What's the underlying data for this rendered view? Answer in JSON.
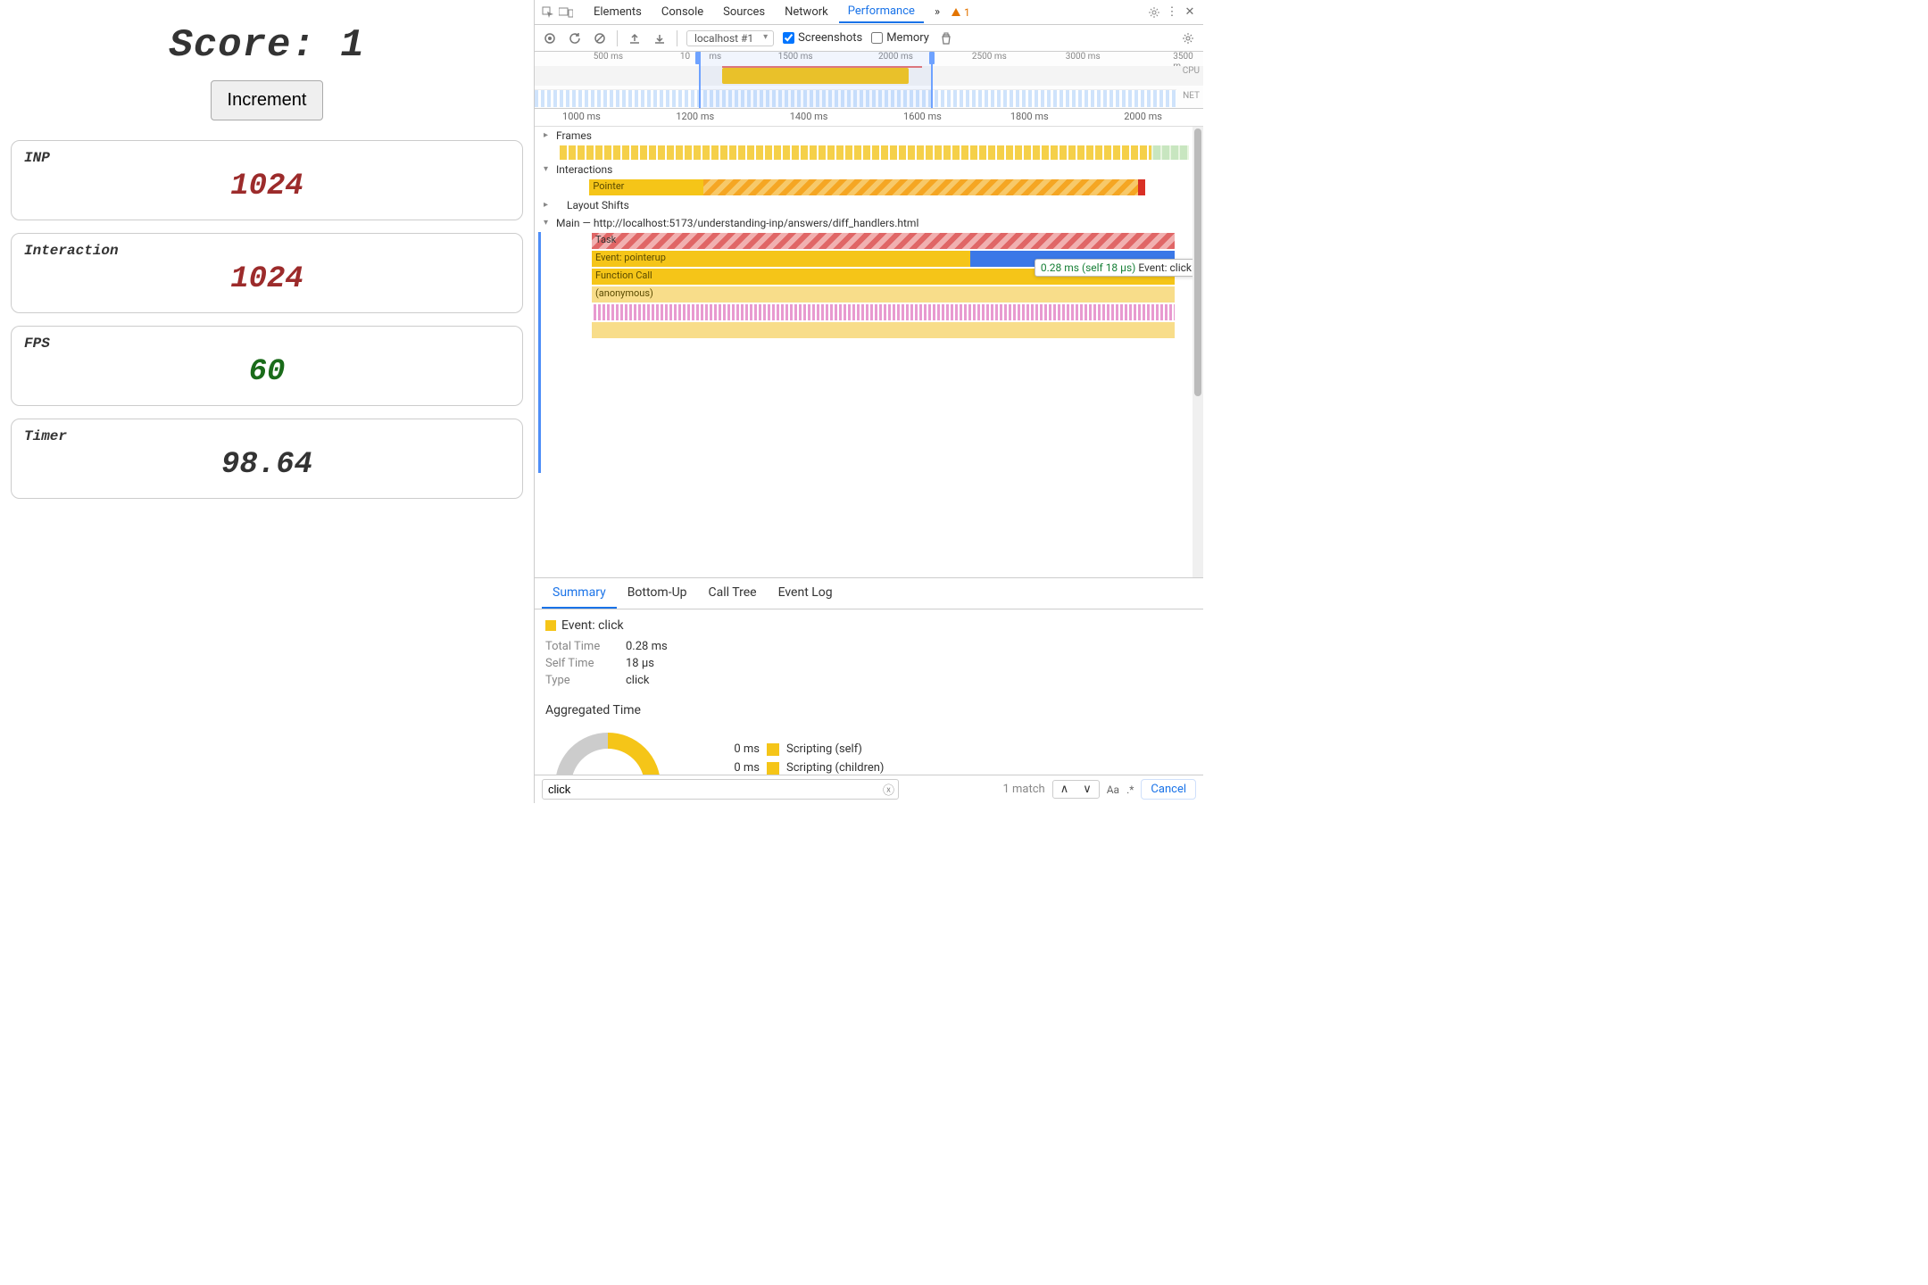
{
  "app": {
    "score_label": "Score:",
    "score_value": "1",
    "increment_label": "Increment",
    "metrics": [
      {
        "label": "INP",
        "value": "1024",
        "color": "red"
      },
      {
        "label": "Interaction",
        "value": "1024",
        "color": "red"
      },
      {
        "label": "FPS",
        "value": "60",
        "color": "green"
      },
      {
        "label": "Timer",
        "value": "98.64",
        "color": "black"
      }
    ]
  },
  "devtools": {
    "tabs": [
      "Elements",
      "Console",
      "Sources",
      "Network",
      "Performance"
    ],
    "active_tab": "Performance",
    "more_indicator": "»",
    "warning_count": "1",
    "toolbar": {
      "session": "localhost #1",
      "screenshots_label": "Screenshots",
      "screenshots_checked": true,
      "memory_label": "Memory",
      "memory_checked": false
    },
    "overview": {
      "ticks": [
        "500 ms",
        "10",
        "ms",
        "1500 ms",
        "2000 ms",
        "2500 ms",
        "3000 ms",
        "3500 m"
      ],
      "cpu_label": "CPU",
      "net_label": "NET"
    },
    "ruler_ticks": [
      "1000 ms",
      "1200 ms",
      "1400 ms",
      "1600 ms",
      "1800 ms",
      "2000 ms"
    ],
    "tracks": {
      "frames": "Frames",
      "interactions": "Interactions",
      "pointer": "Pointer",
      "layout_shifts": "Layout Shifts",
      "main_label": "Main — http://localhost:5173/understanding-inp/answers/diff_handlers.html",
      "task": "Task",
      "event_pointerup": "Event: pointerup",
      "function_call": "Function Call",
      "anonymous": "(anonymous)"
    },
    "tooltip": {
      "timing": "0.28 ms (self 18 µs)",
      "label": "Event: click"
    },
    "summary": {
      "tabs": [
        "Summary",
        "Bottom-Up",
        "Call Tree",
        "Event Log"
      ],
      "active": "Summary",
      "header": "Event: click",
      "total_time_k": "Total Time",
      "total_time_v": "0.28 ms",
      "self_time_k": "Self Time",
      "self_time_v": "18 µs",
      "type_k": "Type",
      "type_v": "click",
      "agg_title": "Aggregated Time",
      "legend": [
        {
          "val": "0 ms",
          "label": "Scripting (self)"
        },
        {
          "val": "0 ms",
          "label": "Scripting (children)"
        }
      ]
    },
    "search": {
      "value": "click",
      "match_text": "1 match",
      "cancel": "Cancel",
      "case_opt": "Aa",
      "regex_opt": ".*"
    }
  }
}
